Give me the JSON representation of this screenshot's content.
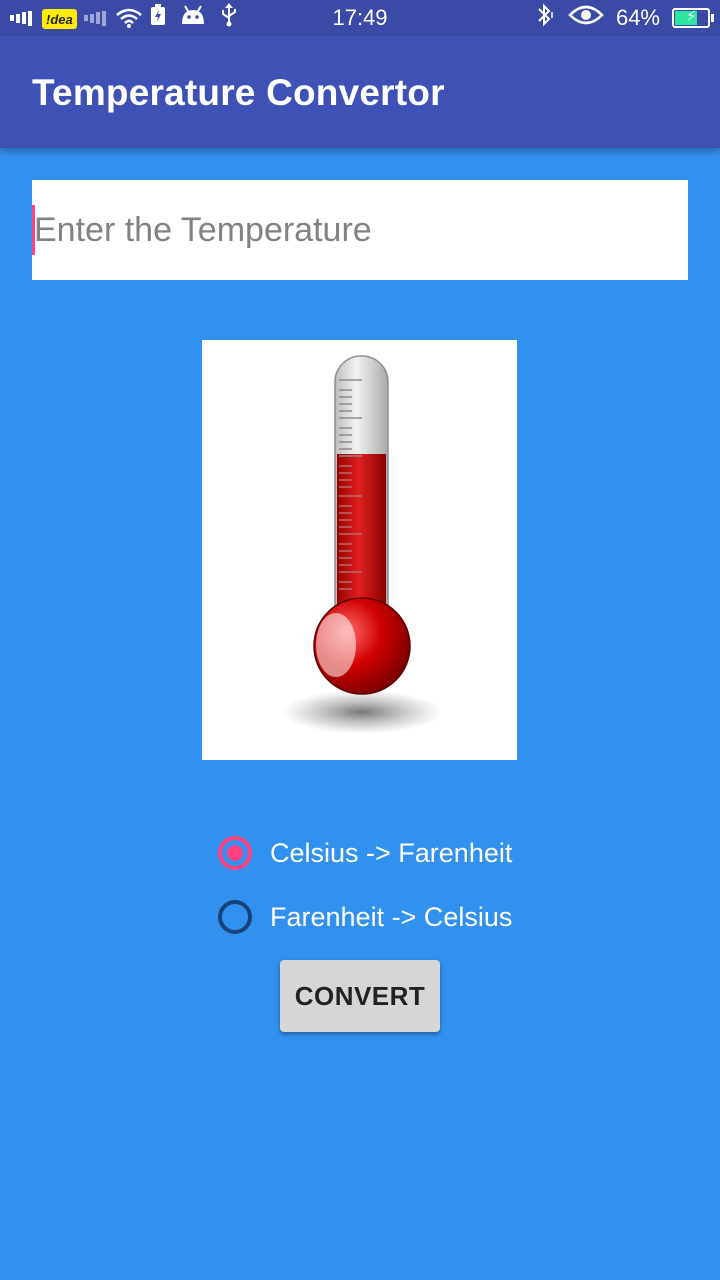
{
  "status_bar": {
    "carrier": "!dea",
    "time": "17:49",
    "battery_percent": "64%",
    "battery_level": 0.64,
    "icons": [
      "signal-icon",
      "wifi-icon",
      "battery-saver-icon",
      "android-icon",
      "usb-icon",
      "bluetooth-icon",
      "eye-icon",
      "battery-icon"
    ]
  },
  "app_bar": {
    "title": "Temperature Convertor"
  },
  "input": {
    "placeholder": "Enter the Temperature",
    "value": ""
  },
  "image": {
    "icon": "thermometer-icon"
  },
  "conversion_options": [
    {
      "label": "Celsius -> Farenheit",
      "checked": true
    },
    {
      "label": "Farenheit -> Celsius",
      "checked": false
    }
  ],
  "convert_button": {
    "label": "CONVERT"
  },
  "colors": {
    "status_bar": "#3A4AA6",
    "app_bar": "#3F51B5",
    "background": "#3291EF",
    "accent": "#FF4081",
    "button": "#D6D6D6"
  }
}
